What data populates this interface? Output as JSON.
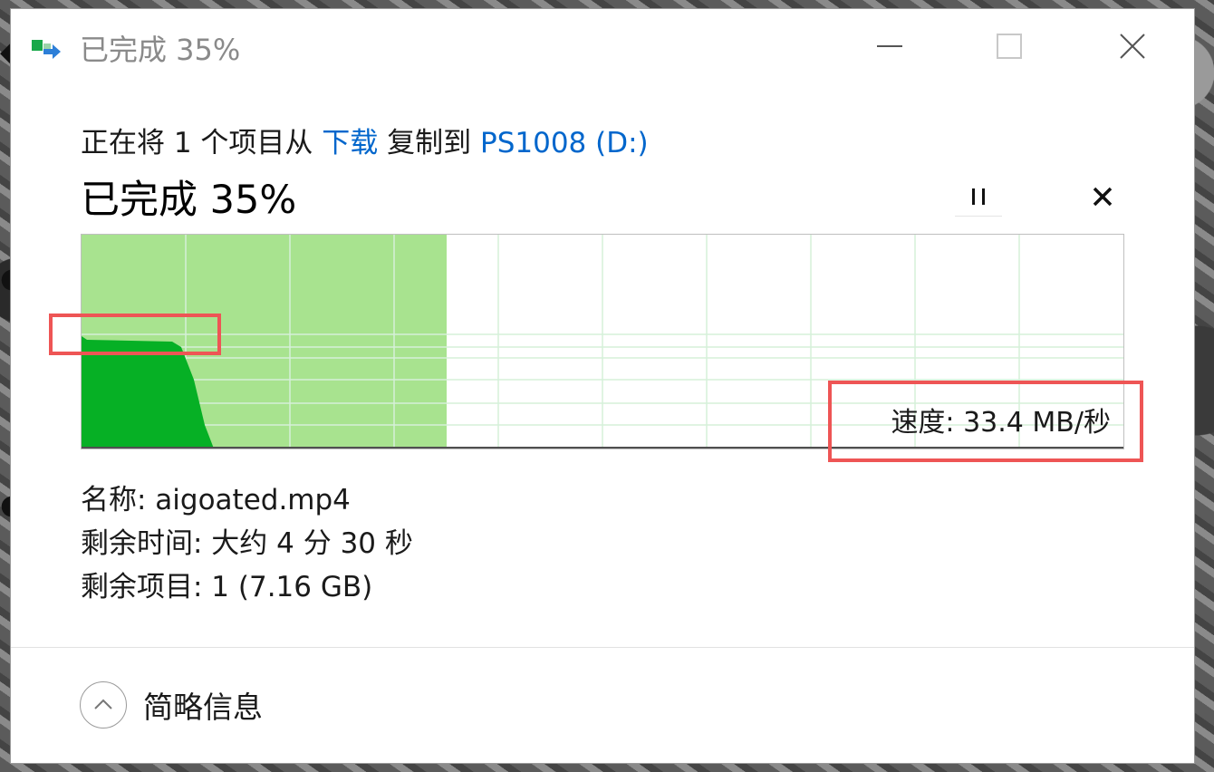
{
  "window": {
    "title": "已完成 35%",
    "controls": {
      "minimize": "minimize-icon",
      "maximize": "maximize-icon",
      "close": "close-icon"
    }
  },
  "copy": {
    "prefix": "正在将 1 个项目从 ",
    "source": "下载",
    "middle": " 复制到 ",
    "destination": "PS1008 (D:)"
  },
  "progress": {
    "label": "已完成 35%",
    "percent": 35,
    "pause_icon": "pause-icon",
    "cancel_icon": "cancel-icon"
  },
  "graph": {
    "speed_label": "速度: 33.4 MB/秒",
    "completed_fraction": 0.35,
    "colors": {
      "completed_fill": "#a8e38f",
      "speed_fill": "#06b025",
      "grid": "#d6f0d9",
      "highlight": "#ee5555"
    }
  },
  "details": {
    "name": "名称: aigoated.mp4",
    "time_remaining": "剩余时间: 大约 4 分 30 秒",
    "items_remaining": "剩余项目: 1 (7.16 GB)"
  },
  "footer": {
    "toggle_label": "简略信息",
    "toggle_icon": "chevron-up-icon"
  }
}
